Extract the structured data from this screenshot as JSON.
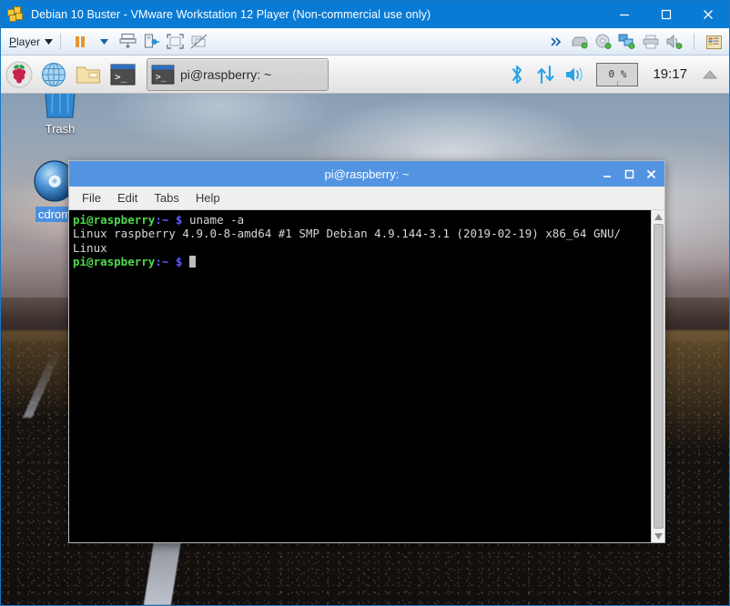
{
  "vmware": {
    "title": "Debian 10 Buster - VMware Workstation 12 Player (Non-commercial use only)",
    "title_icon": "vmware-logo-icon",
    "caption": {
      "minimize": "minimize-icon",
      "maximize": "maximize-icon",
      "close": "close-icon"
    },
    "toolbar": {
      "player_menu_label": "Player",
      "player_menu_caret": "caret-down-icon",
      "items": [
        {
          "name": "pause-button",
          "icon": "pause-icon"
        },
        {
          "name": "pause-dropdown",
          "icon": "caret-down-icon"
        },
        {
          "name": "send-ctrl-alt-del-button",
          "icon": "keyboard-send-icon"
        },
        {
          "name": "removable-devices-button",
          "icon": "usb-plug-icon"
        },
        {
          "name": "enter-fullscreen-button",
          "icon": "fullscreen-icon"
        },
        {
          "name": "unity-mode-button",
          "icon": "unity-disabled-icon"
        }
      ],
      "right_items": [
        {
          "name": "overflow-chevron",
          "icon": "double-chevron-right-icon"
        },
        {
          "name": "hard-disk-status",
          "icon": "hard-disk-icon"
        },
        {
          "name": "cd-dvd-status",
          "icon": "cd-dvd-icon"
        },
        {
          "name": "network-adapter-status",
          "icon": "network-icon"
        },
        {
          "name": "printer-status",
          "icon": "printer-icon"
        },
        {
          "name": "sound-card-status",
          "icon": "speaker-icon"
        },
        {
          "name": "manage-snapshots-button",
          "icon": "snapshot-icon"
        }
      ]
    }
  },
  "desktop": {
    "icons": [
      {
        "name": "desktop-icon-trash",
        "label": "Trash",
        "icon": "trash-bin-icon",
        "selected": false
      },
      {
        "name": "desktop-icon-cdrom",
        "label": "cdrom",
        "icon": "cd-disc-icon",
        "selected": true
      }
    ]
  },
  "panel": {
    "launchers": [
      {
        "name": "menu-button",
        "icon": "raspberry-pi-icon"
      },
      {
        "name": "launcher-web-browser",
        "icon": "globe-browser-icon"
      },
      {
        "name": "launcher-file-manager",
        "icon": "folder-icon"
      },
      {
        "name": "launcher-terminal",
        "icon": "terminal-icon"
      }
    ],
    "task_button": {
      "name": "taskbar-window-button",
      "label": "pi@raspberry: ~",
      "icon": "terminal-icon"
    },
    "tray": [
      {
        "name": "tray-bluetooth",
        "icon": "bluetooth-icon"
      },
      {
        "name": "tray-network",
        "icon": "network-updown-icon"
      },
      {
        "name": "tray-volume",
        "icon": "volume-icon"
      }
    ],
    "cpu_monitor": {
      "name": "cpu-usage-monitor",
      "value": "0 %"
    },
    "clock": "19:17",
    "eject": {
      "name": "tray-eject",
      "icon": "eject-icon"
    }
  },
  "terminal": {
    "title": "pi@raspberry: ~",
    "caption": {
      "minimize": "minimize-icon",
      "maximize": "maximize-icon",
      "close": "close-icon"
    },
    "menu": [
      {
        "name": "term-menu-file",
        "label": "File"
      },
      {
        "name": "term-menu-edit",
        "label": "Edit"
      },
      {
        "name": "term-menu-tabs",
        "label": "Tabs"
      },
      {
        "name": "term-menu-help",
        "label": "Help"
      }
    ],
    "lines": {
      "l1_prompt_user": "pi@raspberry",
      "l1_prompt_path": ":~",
      "l1_prompt_sym": "$",
      "l1_command": " uname -a",
      "l2_output": "Linux raspberry 4.9.0-8-amd64 #1 SMP Debian 4.9.144-3.1 (2019-02-19) x86_64 GNU/",
      "l3_output": "Linux",
      "l4_prompt_user": "pi@raspberry",
      "l4_prompt_path": ":~",
      "l4_prompt_sym": "$"
    },
    "scrollbar": {
      "up_arrow": "scroll-up-icon",
      "down_arrow": "scroll-down-icon"
    }
  },
  "colors": {
    "vmware_title_bar": "#0a7bd4",
    "terminal_title_bar": "#5294e2",
    "terminal_bg": "#000000",
    "prompt_green": "#4ed94e",
    "prompt_blue": "#5c5cff",
    "selection_blue": "#4a90e2",
    "tray_icon_blue": "#29a3e8"
  }
}
